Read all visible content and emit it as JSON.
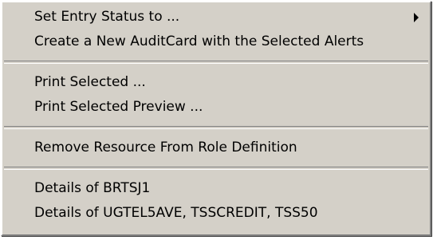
{
  "menu": {
    "groups": [
      {
        "items": [
          {
            "label": "Set Entry Status to ..."
          },
          {
            "label": "Create a New AuditCard with the Selected Alerts"
          }
        ]
      },
      {
        "items": [
          {
            "label": "Print Selected ..."
          },
          {
            "label": "Print Selected Preview ..."
          }
        ]
      },
      {
        "items": [
          {
            "label": "Remove Resource From Role Definition"
          }
        ]
      },
      {
        "items": [
          {
            "label": "Details of BRTSJ1"
          },
          {
            "label": "Details of UGTEL5AVE, TSSCREDIT, TSS50"
          }
        ]
      }
    ],
    "submenu_indicator_icon": "chevron-right-icon"
  }
}
